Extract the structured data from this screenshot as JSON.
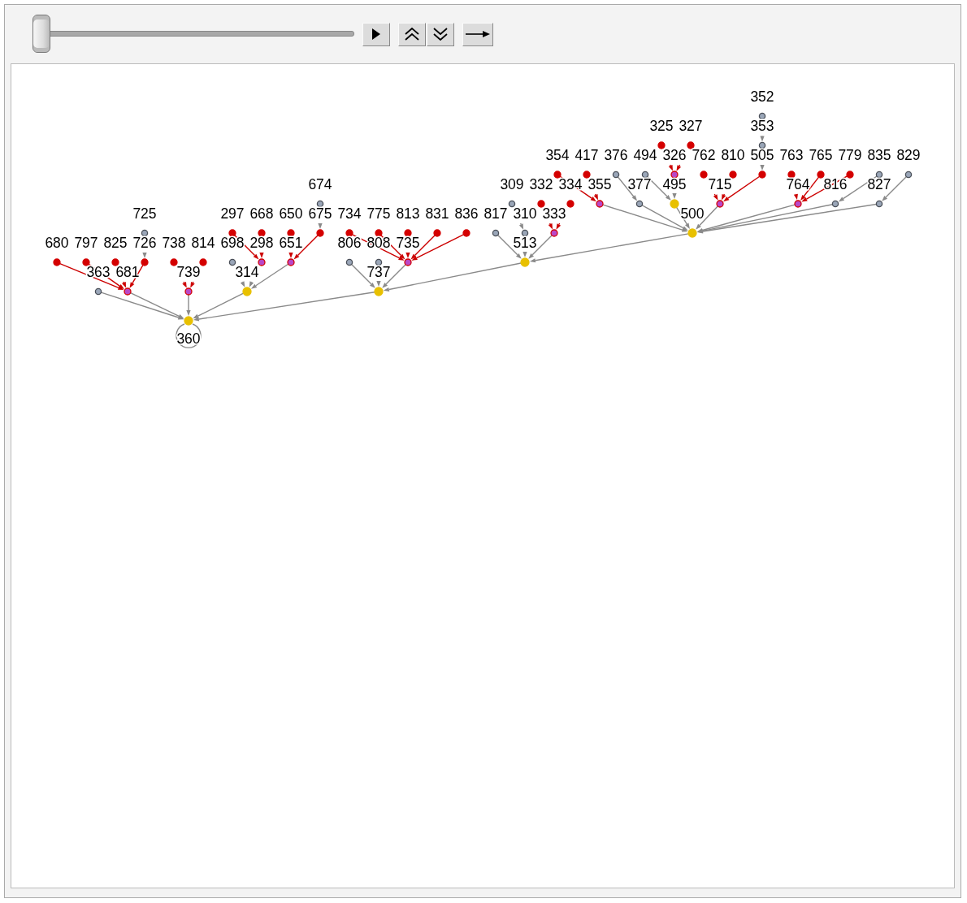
{
  "slider": {
    "level": 0
  },
  "graph": {
    "root": {
      "label": "360",
      "kind": "hub",
      "self_loop": true,
      "children": [
        {
          "label": "363",
          "kind": "plain"
        },
        {
          "label": "681",
          "kind": "merge",
          "children": [
            {
              "label": "680",
              "kind": "source"
            },
            {
              "label": "797",
              "kind": "source"
            },
            {
              "label": "825",
              "kind": "source"
            },
            {
              "label": "726",
              "kind": "source",
              "children": [
                {
                  "label": "725",
                  "kind": "plain"
                }
              ]
            }
          ]
        },
        {
          "label": "739",
          "kind": "merge",
          "children": [
            {
              "label": "738",
              "kind": "source"
            },
            {
              "label": "814",
              "kind": "source"
            }
          ]
        },
        {
          "label": "314",
          "kind": "hub",
          "children": [
            {
              "label": "698",
              "kind": "plain"
            },
            {
              "label": "298",
              "kind": "merge",
              "children": [
                {
                  "label": "297",
                  "kind": "source"
                },
                {
                  "label": "668",
                  "kind": "source"
                }
              ]
            },
            {
              "label": "651",
              "kind": "merge",
              "children": [
                {
                  "label": "650",
                  "kind": "source"
                },
                {
                  "label": "675",
                  "kind": "source",
                  "children": [
                    {
                      "label": "674",
                      "kind": "plain"
                    }
                  ]
                }
              ]
            }
          ]
        },
        {
          "label": "737",
          "kind": "hub",
          "children": [
            {
              "label": "806",
              "kind": "plain"
            },
            {
              "label": "808",
              "kind": "plain"
            },
            {
              "label": "735",
              "kind": "merge",
              "children": [
                {
                  "label": "734",
                  "kind": "source"
                },
                {
                  "label": "775",
                  "kind": "source"
                },
                {
                  "label": "813",
                  "kind": "source"
                },
                {
                  "label": "831",
                  "kind": "source"
                },
                {
                  "label": "836",
                  "kind": "source"
                }
              ]
            },
            {
              "label": "513",
              "kind": "hub",
              "children": [
                {
                  "label": "817",
                  "kind": "plain"
                },
                {
                  "label": "310",
                  "kind": "plain",
                  "children": [
                    {
                      "label": "309",
                      "kind": "plain"
                    }
                  ]
                },
                {
                  "label": "333",
                  "kind": "merge",
                  "children": [
                    {
                      "label": "332",
                      "kind": "source"
                    },
                    {
                      "label": "334",
                      "kind": "source"
                    }
                  ]
                },
                {
                  "label": "500",
                  "kind": "hub",
                  "children": [
                    {
                      "label": "355",
                      "kind": "merge",
                      "children": [
                        {
                          "label": "354",
                          "kind": "source"
                        },
                        {
                          "label": "417",
                          "kind": "source"
                        }
                      ]
                    },
                    {
                      "label": "377",
                      "kind": "plain",
                      "children": [
                        {
                          "label": "376",
                          "kind": "plain"
                        }
                      ]
                    },
                    {
                      "label": "495",
                      "kind": "hub",
                      "children": [
                        {
                          "label": "494",
                          "kind": "plain"
                        },
                        {
                          "label": "326",
                          "kind": "merge",
                          "children": [
                            {
                              "label": "325",
                              "kind": "source"
                            },
                            {
                              "label": "327",
                              "kind": "source"
                            }
                          ]
                        }
                      ]
                    },
                    {
                      "label": "715",
                      "kind": "merge",
                      "children": [
                        {
                          "label": "762",
                          "kind": "source"
                        },
                        {
                          "label": "810",
                          "kind": "source"
                        },
                        {
                          "label": "505",
                          "kind": "source",
                          "children": [
                            {
                              "label": "353",
                              "kind": "plain",
                              "children": [
                                {
                                  "label": "352",
                                  "kind": "plain"
                                }
                              ]
                            }
                          ]
                        }
                      ]
                    },
                    {
                      "label": "764",
                      "kind": "merge",
                      "children": [
                        {
                          "label": "763",
                          "kind": "source"
                        },
                        {
                          "label": "765",
                          "kind": "source"
                        },
                        {
                          "label": "779",
                          "kind": "source"
                        }
                      ]
                    },
                    {
                      "label": "816",
                      "kind": "plain",
                      "children": [
                        {
                          "label": "835",
                          "kind": "plain"
                        }
                      ]
                    },
                    {
                      "label": "827",
                      "kind": "plain",
                      "children": [
                        {
                          "label": "829",
                          "kind": "plain"
                        }
                      ]
                    }
                  ]
                }
              ]
            }
          ]
        }
      ]
    }
  }
}
